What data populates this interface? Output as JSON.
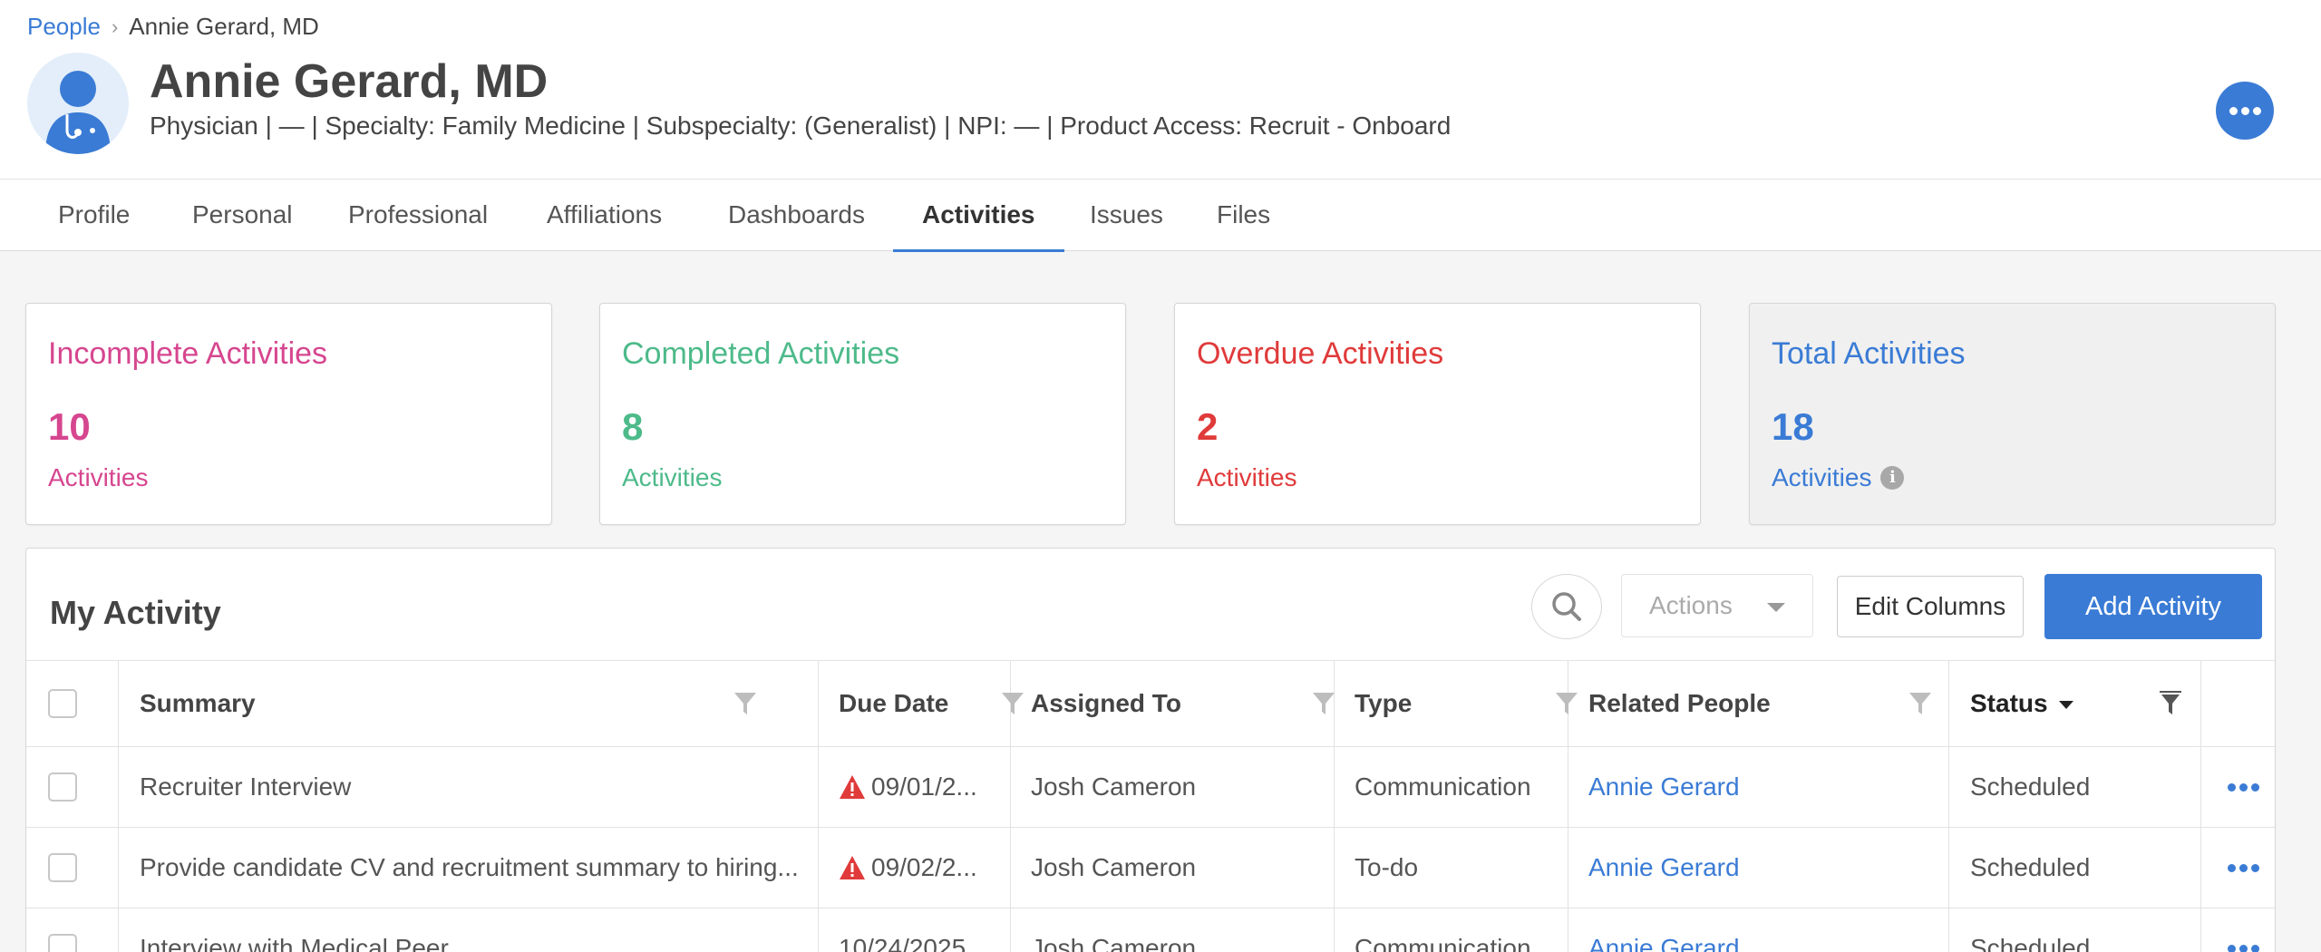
{
  "breadcrumb": {
    "parent": "People",
    "separator": "›",
    "current": "Annie Gerard, MD"
  },
  "profile": {
    "name": "Annie Gerard, MD",
    "subline": "Physician | — | Specialty: Family Medicine | Subspecialty: (Generalist) | NPI: — | Product Access: Recruit - Onboard",
    "avatar_icon": "doctor-avatar-icon"
  },
  "tabs": [
    {
      "label": "Profile"
    },
    {
      "label": "Personal"
    },
    {
      "label": "Professional"
    },
    {
      "label": "Affiliations"
    },
    {
      "label": "Dashboards"
    },
    {
      "label": "Activities",
      "active": true
    },
    {
      "label": "Issues"
    },
    {
      "label": "Files"
    }
  ],
  "summary_cards": [
    {
      "title": "Incomplete Activities",
      "count": "10",
      "unit": "Activities",
      "color": "#d6468f"
    },
    {
      "title": "Completed Activities",
      "count": "8",
      "unit": "Activities",
      "color": "#4dba8a"
    },
    {
      "title": "Overdue Activities",
      "count": "2",
      "unit": "Activities",
      "color": "#e03a3a"
    },
    {
      "title": "Total Activities",
      "count": "18",
      "unit": "Activities",
      "color": "#3a7bd5",
      "info_icon": "i"
    }
  ],
  "activity": {
    "title": "My Activity",
    "actions_label": "Actions",
    "edit_columns_label": "Edit Columns",
    "add_activity_label": "Add Activity",
    "columns": [
      "Summary",
      "Due Date",
      "Assigned To",
      "Type",
      "Related People",
      "Status"
    ],
    "rows": [
      {
        "summary": "Recruiter Interview",
        "due": "09/01/2...",
        "overdue": true,
        "assigned": "Josh Cameron",
        "type": "Communication",
        "related": "Annie Gerard",
        "status": "Scheduled"
      },
      {
        "summary": "Provide candidate CV and recruitment summary to hiring...",
        "due": "09/02/2...",
        "overdue": true,
        "assigned": "Josh Cameron",
        "type": "To-do",
        "related": "Annie Gerard",
        "status": "Scheduled"
      },
      {
        "summary": "Interview with Medical Peer",
        "due": "10/24/2025",
        "overdue": false,
        "assigned": "Josh Cameron",
        "type": "Communication",
        "related": "Annie Gerard",
        "status": "Scheduled"
      }
    ]
  },
  "colors": {
    "accent": "#3a7bd5",
    "warning": "#e03a3a"
  }
}
